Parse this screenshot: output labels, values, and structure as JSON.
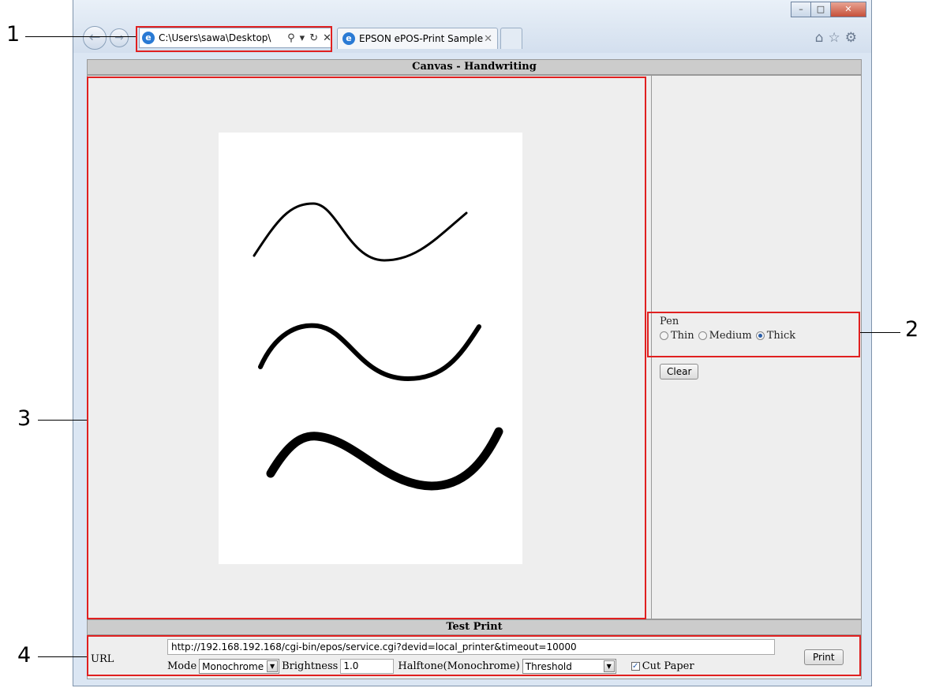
{
  "browser": {
    "address": "C:\\Users\\sawa\\Desktop\\",
    "tab_title": "EPSON ePOS-Print Sample ...",
    "ie_glyph": "e"
  },
  "canvas_section": {
    "title": "Canvas - Handwriting",
    "pen_label": "Pen",
    "pen_options": [
      "Thin",
      "Medium",
      "Thick"
    ],
    "pen_selected": "Thick",
    "clear_label": "Clear"
  },
  "test_print": {
    "title": "Test Print",
    "url_label": "URL",
    "url_value": "http://192.168.192.168/cgi-bin/epos/service.cgi?devid=local_printer&timeout=10000",
    "mode_label": "Mode",
    "mode_value": "Monochrome",
    "brightness_label": "Brightness",
    "brightness_value": "1.0",
    "halftone_label": "Halftone(Monochrome)",
    "halftone_value": "Threshold",
    "cut_paper_label": "Cut Paper",
    "cut_paper_checked": true,
    "print_label": "Print"
  },
  "callouts": {
    "c1": "1",
    "c2": "2",
    "c3": "3",
    "c4": "4"
  },
  "colors": {
    "highlight": "#e02020"
  }
}
